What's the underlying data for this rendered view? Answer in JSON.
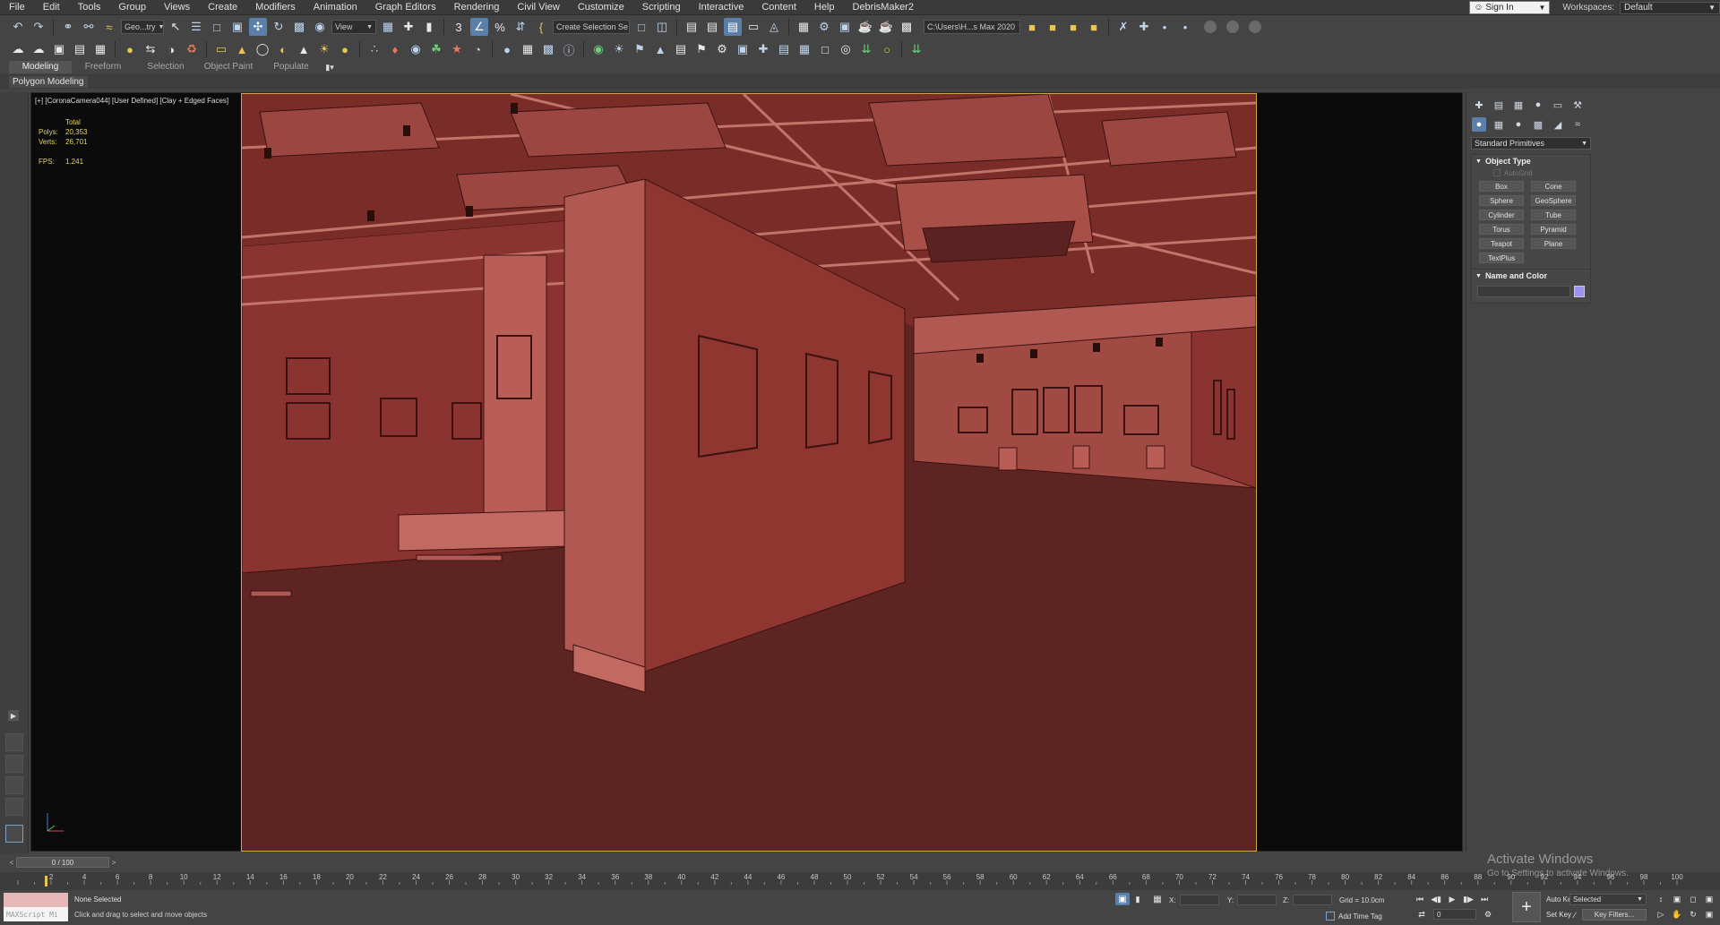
{
  "menu": [
    "File",
    "Edit",
    "Tools",
    "Group",
    "Views",
    "Create",
    "Modifiers",
    "Animation",
    "Graph Editors",
    "Rendering",
    "Civil View",
    "Customize",
    "Scripting",
    "Interactive",
    "Content",
    "Help",
    "DebrisMaker2"
  ],
  "account": {
    "sign_in": "Sign In",
    "workspaces_label": "Workspaces:",
    "workspace": "Default"
  },
  "toolbar": {
    "selection_filter": "Geo...try",
    "ref_coord": "View",
    "named_selection": "Create Selection Se",
    "project_path": "C:\\Users\\H...s Max 2020"
  },
  "ribbon": {
    "tabs": [
      "Modeling",
      "Freeform",
      "Selection",
      "Object Paint",
      "Populate"
    ],
    "panel": "Polygon Modeling"
  },
  "viewport": {
    "label": "[+] [CoronaCamera044] [User Defined] [Clay + Edged Faces]",
    "stats_header": "Total",
    "stats": [
      {
        "k": "Polys:",
        "v": "20,353"
      },
      {
        "k": "Verts:",
        "v": "26,701"
      }
    ],
    "fps_label": "FPS:",
    "fps": "1.241",
    "colors": {
      "background": "#0b0b0b",
      "safe_frame": "#c9a94a",
      "floor": "#5e2421",
      "wall": "#8c3430",
      "ceiling": "#7c2e2a"
    }
  },
  "command_panel": {
    "category": "Standard Primitives",
    "object_type_title": "Object Type",
    "autogrid": "AutoGrid",
    "primitives": [
      "Box",
      "Cone",
      "Sphere",
      "GeoSphere",
      "Cylinder",
      "Tube",
      "Torus",
      "Pyramid",
      "Teapot",
      "Plane",
      "TextPlus"
    ],
    "name_color_title": "Name and Color",
    "object_color": "#9a93f0"
  },
  "timeline": {
    "frame_range": "0 / 100",
    "ticks": [
      "0",
      "2",
      "4",
      "6",
      "8",
      "10",
      "12",
      "14",
      "16",
      "18",
      "20",
      "22",
      "24",
      "26",
      "28",
      "30",
      "32",
      "34",
      "36",
      "38",
      "40",
      "42",
      "44",
      "46",
      "48",
      "50",
      "52",
      "54",
      "56",
      "58",
      "60",
      "62",
      "64",
      "66",
      "68",
      "70",
      "72",
      "74",
      "76",
      "78",
      "80",
      "82",
      "84",
      "86",
      "88",
      "90",
      "92",
      "94",
      "96",
      "98",
      "100"
    ]
  },
  "status": {
    "maxscript": "MAXScript Mi",
    "selection": "None Selected",
    "prompt": "Click and drag to select and move objects",
    "x_label": "X:",
    "y_label": "Y:",
    "z_label": "Z:",
    "grid": "Grid = 10.0cm",
    "add_time_tag": "Add Time Tag",
    "auto_key": "Auto Key",
    "set_key": "Set Key",
    "key_mode": "Selected",
    "key_filters": "Key Filters...",
    "current_frame": "0"
  },
  "watermark": {
    "title": "Activate Windows",
    "subtitle": "Go to Settings to activate Windows."
  }
}
